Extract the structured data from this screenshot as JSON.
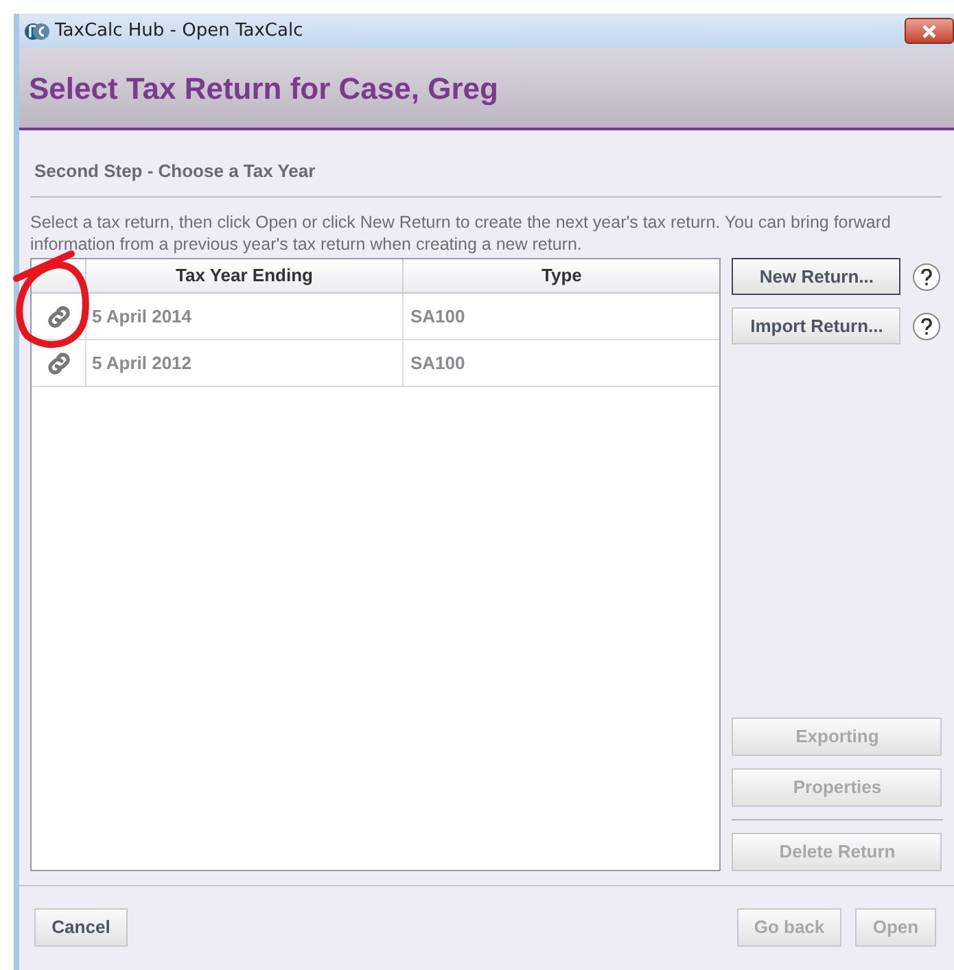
{
  "window": {
    "title": "TaxCalc Hub - Open TaxCalc"
  },
  "header": {
    "title": "Select Tax Return for Case, Greg"
  },
  "step": {
    "title": "Second Step - Choose a Tax Year",
    "description": "Select a tax return, then click Open or click New Return to create the next year's tax return. You can bring forward information from a previous year's tax return when creating a new return."
  },
  "table": {
    "columns": [
      "Tax Year Ending",
      "Type"
    ],
    "rows": [
      {
        "tax_year_ending": "5 April 2014",
        "type": "SA100",
        "selected": false
      },
      {
        "tax_year_ending": "5 April 2012",
        "type": "SA100",
        "selected": false
      }
    ]
  },
  "side_buttons": [
    {
      "label": "New Return...",
      "disabled": false,
      "focused": true,
      "help": true
    },
    {
      "label": "Import Return...",
      "disabled": false,
      "focused": false,
      "help": true
    }
  ],
  "action_buttons": [
    {
      "label": "Exporting",
      "disabled": true
    },
    {
      "label": "Properties",
      "disabled": true
    },
    {
      "label": "Delete Return",
      "disabled": true,
      "separated": true
    }
  ],
  "footer": {
    "left": [
      {
        "label": "Cancel",
        "disabled": false
      }
    ],
    "right": [
      {
        "label": "Go back",
        "disabled": true
      },
      {
        "label": "Open",
        "disabled": true
      }
    ]
  },
  "annotations": [
    {
      "kind": "circle"
    }
  ]
}
